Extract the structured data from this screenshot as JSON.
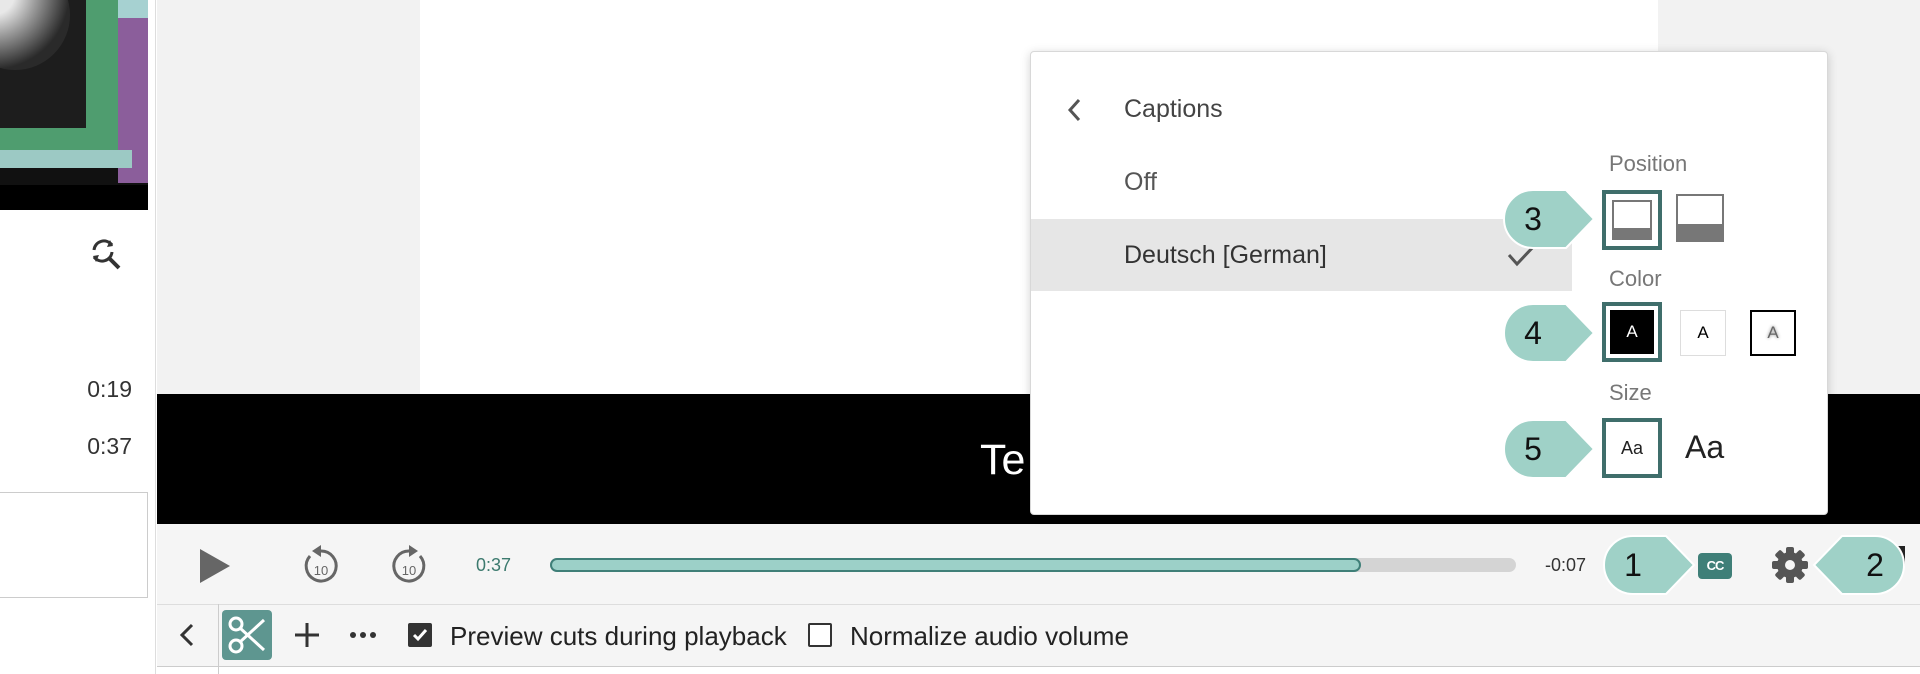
{
  "sidebar": {
    "timestamps": [
      "0:19",
      "0:37"
    ]
  },
  "video": {
    "caption_text": "Te"
  },
  "player": {
    "current_time": "0:37",
    "remaining_time": "-0:07",
    "progress_percent": 84,
    "rewind_seconds": "10",
    "forward_seconds": "10",
    "cc_label": "CC",
    "preview_label": "iew"
  },
  "captions_menu": {
    "title": "Captions",
    "options": [
      "Off",
      "Deutsch [German]"
    ],
    "selected": "Deutsch [German]",
    "position_label": "Position",
    "color_label": "Color",
    "size_label": "Size",
    "color_sample": "A",
    "size_small": "Aa",
    "size_large": "Aa"
  },
  "callouts": [
    "1",
    "2",
    "3",
    "4",
    "5"
  ],
  "toolbar": {
    "preview_cuts_label": "Preview cuts during playback",
    "preview_cuts_checked": true,
    "normalize_label": "Normalize audio volume",
    "normalize_checked": false
  },
  "colors": {
    "accent": "#3f7f78",
    "progress_fill": "#9cd0c8",
    "callout": "#9fd1c7"
  }
}
